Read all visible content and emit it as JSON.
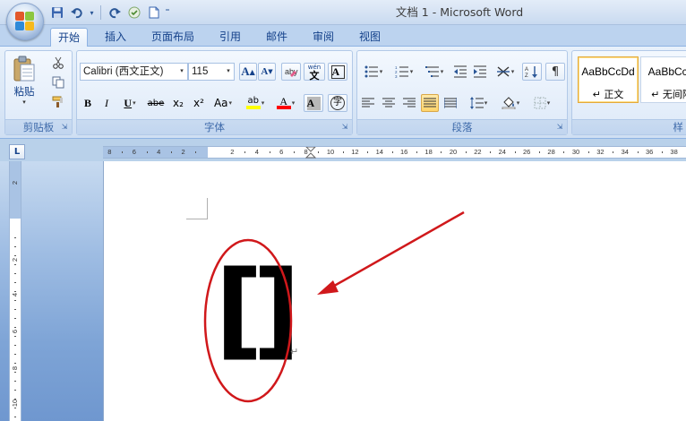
{
  "window": {
    "title": "文档 1 - Microsoft Word"
  },
  "quick_access": {
    "buttons": [
      "save-icon",
      "undo-icon",
      "redo-icon",
      "spell-icon",
      "new-doc-icon"
    ]
  },
  "tabs": [
    {
      "label": "开始",
      "active": true
    },
    {
      "label": "插入",
      "active": false
    },
    {
      "label": "页面布局",
      "active": false
    },
    {
      "label": "引用",
      "active": false
    },
    {
      "label": "邮件",
      "active": false
    },
    {
      "label": "审阅",
      "active": false
    },
    {
      "label": "视图",
      "active": false
    }
  ],
  "clipboard": {
    "label": "剪贴板",
    "paste_label": "粘贴"
  },
  "font": {
    "label": "字体",
    "name": "Calibri (西文正文)",
    "size": "115",
    "bold": "B",
    "italic": "I",
    "underline": "U",
    "strike": "abe",
    "subscript": "x₂",
    "superscript": "x²",
    "change_case": "Aa",
    "grow": "A",
    "shrink": "A",
    "highlight": "ab",
    "font_color": "A",
    "char_shading": "A",
    "phonetic": "wén",
    "phonetic_char": "文",
    "char_border": "A",
    "enclose": "字",
    "highlight_color": "#ffff00",
    "font_color_value": "#ff0000"
  },
  "paragraph": {
    "label": "段落"
  },
  "styles": [
    {
      "sample": "AaBbCcDd",
      "name": "正文",
      "selected": true
    },
    {
      "sample": "AaBbCcD",
      "name": "无间隔",
      "selected": false
    }
  ],
  "styles_group_label": "样",
  "ruler": {
    "h_ticks": [
      "8",
      "6",
      "4",
      "2",
      "2",
      "4",
      "6",
      "8",
      "10",
      "12",
      "14",
      "16",
      "18",
      "20",
      "22",
      "24",
      "26",
      "28",
      "30",
      "32",
      "34",
      "36",
      "38"
    ],
    "v_ticks": [
      "2",
      "2",
      "4",
      "6",
      "8",
      "10"
    ],
    "corner": "L"
  },
  "document": {
    "left_bracket": "[",
    "right_bracket": "]",
    "paragraph_mark": "↵"
  },
  "annotation": {
    "color": "#d0181b"
  }
}
